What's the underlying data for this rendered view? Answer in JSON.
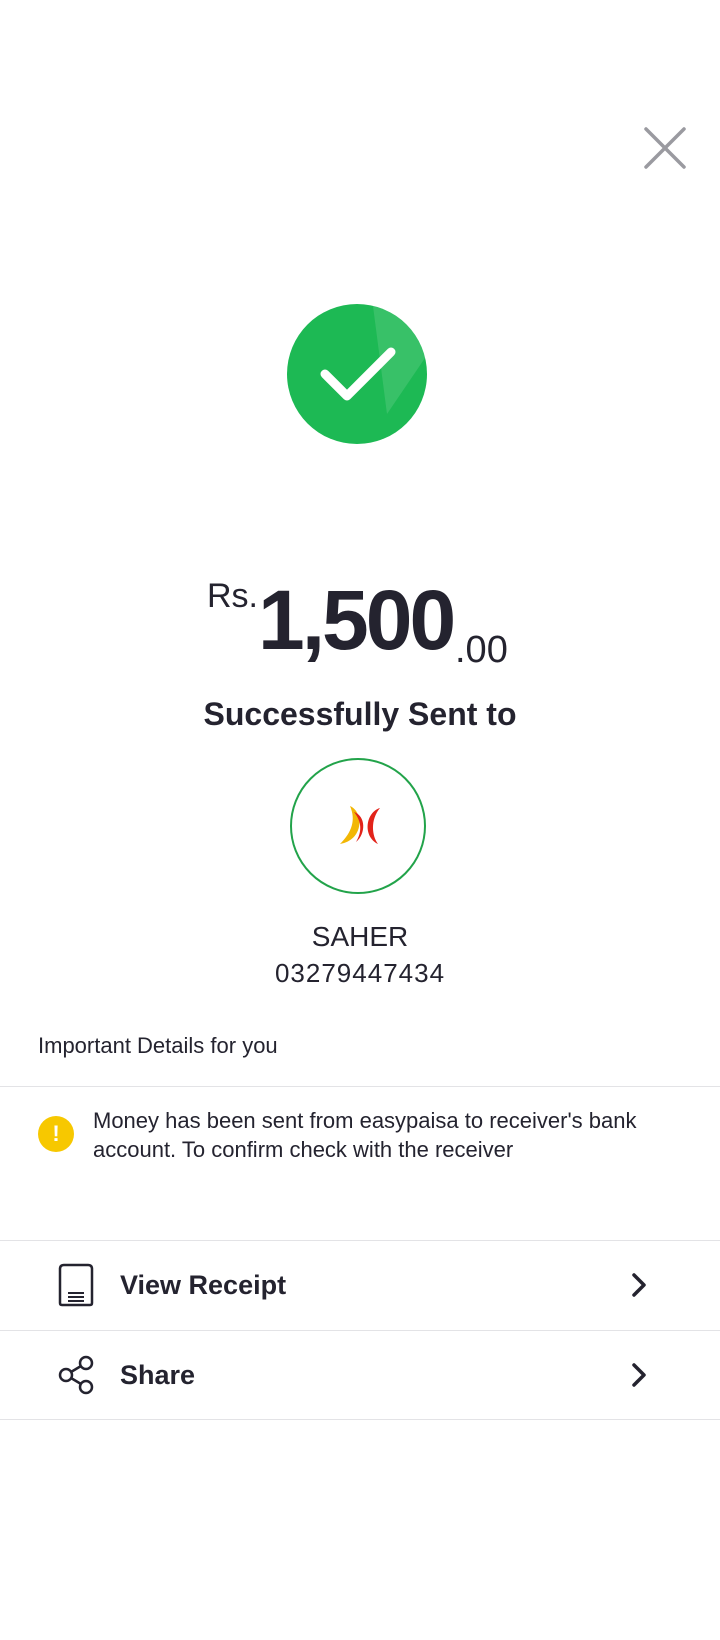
{
  "header": {
    "close_icon": "close-icon"
  },
  "status": {
    "icon": "check-circle-icon",
    "color": "#1db954"
  },
  "amount": {
    "currency": "Rs.",
    "whole": "1,500",
    "decimal": ".00"
  },
  "message": "Successfully Sent to",
  "recipient": {
    "avatar_icon": "bank-logo-icon",
    "name": "SAHER",
    "number": "03279447434"
  },
  "details": {
    "heading": "Important Details for you",
    "notice_icon": "warning-icon",
    "notice_icon_glyph": "!",
    "notice_text": "Money has been sent from easypaisa to receiver's bank account. To confirm check with the receiver"
  },
  "actions": [
    {
      "label": "View Receipt",
      "icon": "receipt-icon"
    },
    {
      "label": "Share",
      "icon": "share-icon"
    }
  ],
  "colors": {
    "accent_green": "#1db954",
    "avatar_border": "#22a34a",
    "warning_yellow": "#f7c800",
    "text_dark": "#24232f"
  }
}
